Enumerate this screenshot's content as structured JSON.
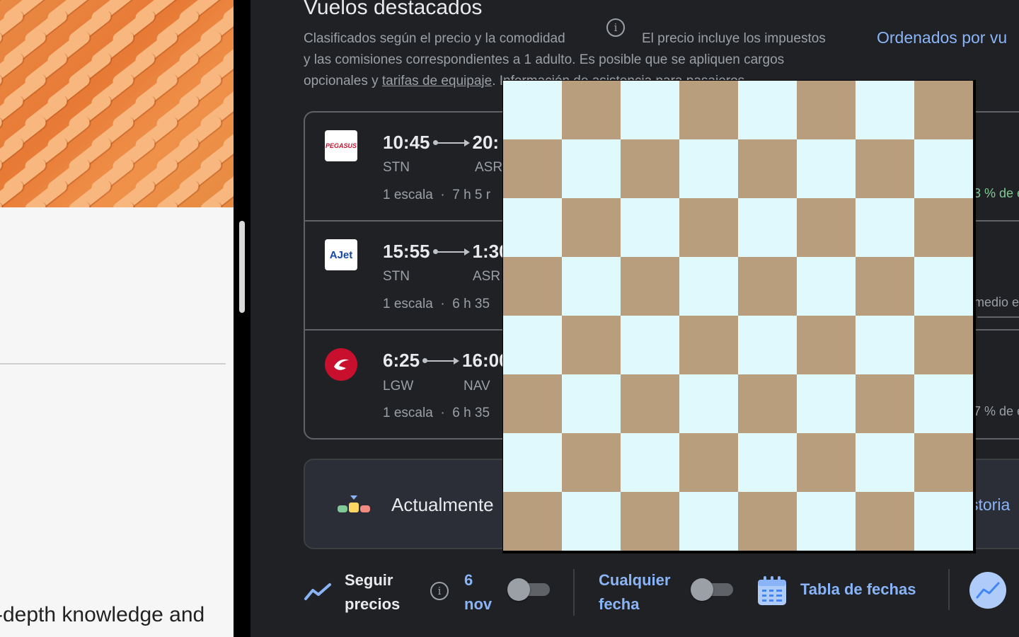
{
  "left_panel": {
    "bottom_text": "-depth knowledge and"
  },
  "main": {
    "section_title": "Vuelos destacados",
    "desc_part1": "Clasificados según el precio y la comodidad",
    "desc_part2": "El precio incluye los impuestos",
    "desc_line2": "y las comisiones correspondientes a 1 adulto. Es posible que se apliquen cargos",
    "desc_line3_prefix": "opcionales y ",
    "desc_line3_link": "tarifas de equipaje",
    "desc_line3_suffix": ". Información de asistencia para pasajeros",
    "sort_link": "Ordenados por vu"
  },
  "flights": [
    {
      "airline_logo_text": "PEGASUS",
      "depart": "10:45",
      "arrive": "20:",
      "from": "STN",
      "to": "ASR",
      "stops": "1 escala",
      "duration": "7 h 5 r",
      "note": "3 % de e",
      "note_color": "#81c995"
    },
    {
      "airline_logo_text": "AJet",
      "depart": "15:55",
      "arrive": "1:30",
      "from": "STN",
      "to": "ASR",
      "stops": "1 escala",
      "duration": "6 h 35",
      "note": "medio e",
      "note_color": "#9aa0a6"
    },
    {
      "airline_logo_text": "",
      "depart": "6:25",
      "arrive": "16:00",
      "from": "LGW",
      "to": "NAV",
      "stops": "1 escala",
      "duration": "6 h 35",
      "note": "7 % de e",
      "note_color": "#9aa0a6"
    }
  ],
  "price_card": {
    "text": "Actualmente",
    "link": "storia"
  },
  "toolbar": {
    "track_line1": "Seguir",
    "track_line2": "precios",
    "track_date_line1": "6",
    "track_date_line2": "nov",
    "any_date_line1": "Cualquier",
    "any_date_line2": "fecha",
    "date_table": "Tabla de fechas"
  },
  "checkerboard": {
    "rows": 8,
    "cols": 8,
    "light_color": "#dff9fd",
    "dark_color": "#b89e7c"
  },
  "colors": {
    "background": "#202124",
    "link": "#8ab4f8",
    "muted": "#9aa0a6",
    "positive": "#81c995"
  }
}
